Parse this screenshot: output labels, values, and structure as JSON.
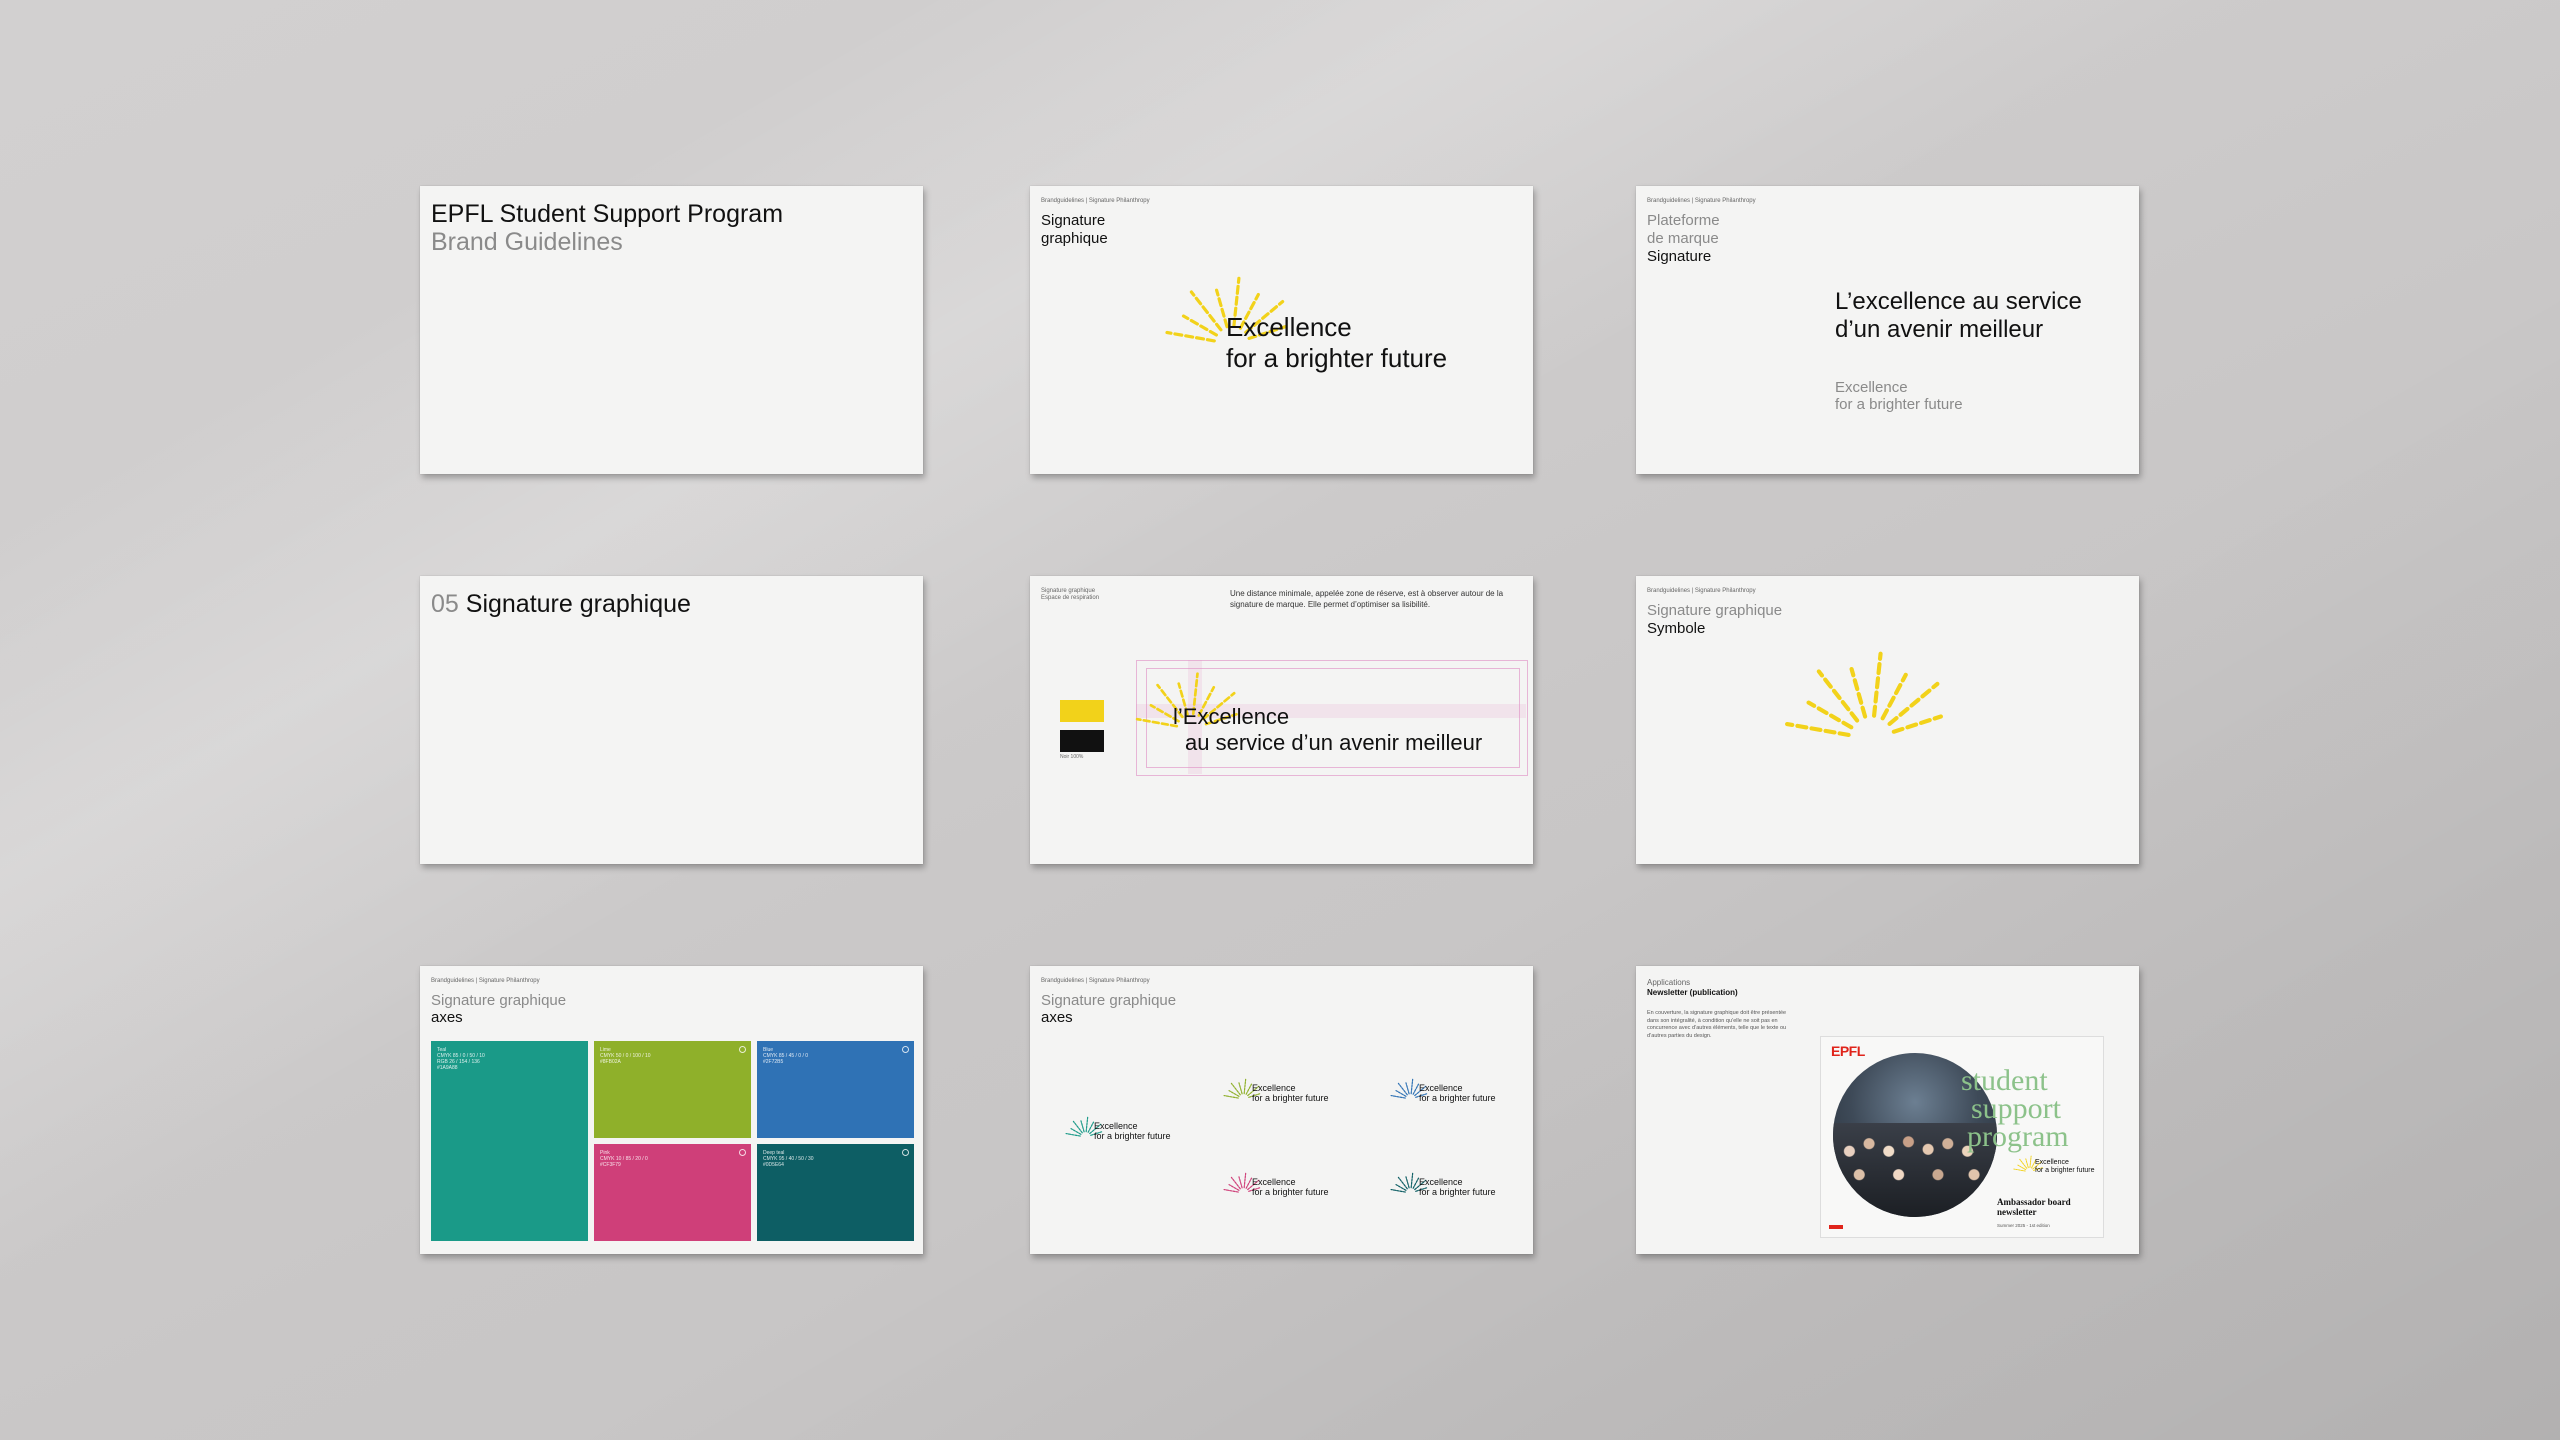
{
  "card1": {
    "title": "EPFL Student Support Program",
    "subtitle": "Brand Guidelines"
  },
  "card2": {
    "crumb": "Brandguidelines | Signature Philanthropy",
    "label": "Signature\ngraphique",
    "line1": "Excellence",
    "line2": "for a brighter future"
  },
  "card3": {
    "crumb": "Brandguidelines | Signature Philanthropy",
    "label_gray": "Plateforme\nde marque",
    "label": "Signature",
    "headline": "L’excellence au service\nd’un avenir meilleur",
    "sub": "Excellence\nfor a brighter future"
  },
  "card4": {
    "number": "05",
    "title": "Signature graphique"
  },
  "card5": {
    "crumb": "Signature graphique\nEspace de respiration",
    "note": "Une distance minimale, appelée zone de réserve, est à observer autour de la signature de marque. Elle permet d’optimiser sa lisibilité.",
    "line1": "l’Excellence",
    "line2": "au service d’un avenir meilleur",
    "swatch_caption": "Noir 100%"
  },
  "card6": {
    "crumb": "Brandguidelines | Signature Philanthropy",
    "label_gray": "Signature graphique",
    "label": "Symbole"
  },
  "card7": {
    "crumb": "Brandguidelines | Signature Philanthropy",
    "label_gray": "Signature graphique",
    "label": "axes",
    "swatches": [
      {
        "name": "teal",
        "color": "#1a9a88"
      },
      {
        "name": "lime",
        "color": "#8fb02a"
      },
      {
        "name": "blue",
        "color": "#2f72b5"
      },
      {
        "name": "pink",
        "color": "#cf3f79"
      },
      {
        "name": "deep-teal",
        "color": "#0d5e64"
      }
    ]
  },
  "card8": {
    "crumb": "Brandguidelines | Signature Philanthropy",
    "label_gray": "Signature graphique",
    "label": "axes",
    "sig_line1": "Excellence",
    "sig_line2": "for a brighter future",
    "sig_colors": [
      "#1a9a88",
      "#8fb02a",
      "#2f72b5",
      "#cf3f79",
      "#0d5e64"
    ]
  },
  "card9": {
    "crumb": "Applications",
    "label": "Newsletter (publication)",
    "body": "En couverture, la signature graphique doit être présentée dans son intégralité, à condition qu’elle ne soit pas en concurrence avec d’autres éléments, telle que le texte ou d’autres parties du design.",
    "epfl": "EPFL",
    "word1": "student",
    "word2": "support",
    "word3": "program",
    "sig_line1": "Excellence",
    "sig_line2": "for a brighter future",
    "newsletter": "Ambassador board\nnewsletter",
    "edition": "Summer 2025 - 1st edition"
  },
  "colors": {
    "yellow": "#f2d21a",
    "black": "#111111",
    "epfl_red": "#e0241b",
    "newsletter_green": "#8cc28a"
  }
}
